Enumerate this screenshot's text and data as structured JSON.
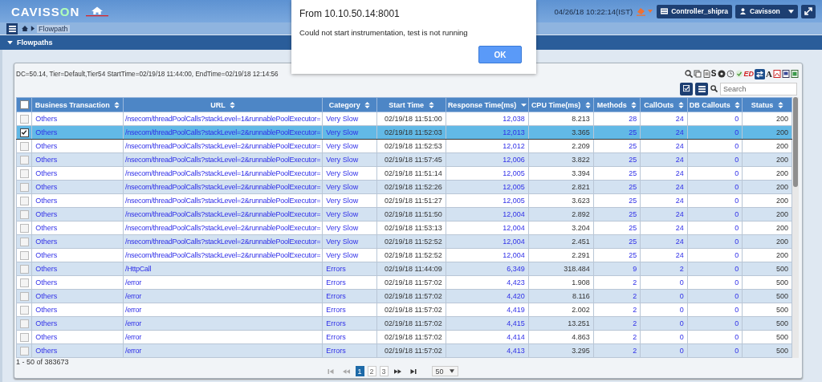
{
  "header": {
    "logo": {
      "before": "CAVISS",
      "accent": "O",
      "after": "N"
    },
    "datetime": "04/26/18 10:22:14(IST)",
    "controller": "Controller_shipra",
    "user": "Cavisson"
  },
  "breadcrumb": {
    "current": "Flowpath"
  },
  "section": {
    "title": "Flowpaths",
    "expanded": true
  },
  "info": "DC=50.14, Tier=Default,Tier54 StartTime=02/19/18 11:44:00, EndTime=02/19/18 12:14:56",
  "toolbar_glyphs": [
    "S",
    "ED",
    "A"
  ],
  "search": {
    "placeholder": "Search"
  },
  "table": {
    "all_checked": false,
    "columns": [
      {
        "label": "Business Transaction",
        "kind": "link",
        "sorted": false
      },
      {
        "label": "URL",
        "kind": "link",
        "sorted": false
      },
      {
        "label": "Category",
        "kind": "link",
        "sorted": false
      },
      {
        "label": "Start Time",
        "kind": "value",
        "sorted": false
      },
      {
        "label": "Response Time(ms)",
        "kind": "count",
        "sorted": true
      },
      {
        "label": "CPU Time(ms)",
        "kind": "value",
        "sorted": false
      },
      {
        "label": "Methods",
        "kind": "count",
        "sorted": false
      },
      {
        "label": "CallOuts",
        "kind": "count",
        "sorted": false
      },
      {
        "label": "DB Callouts",
        "kind": "count",
        "sorted": false
      },
      {
        "label": "Status",
        "kind": "value",
        "sorted": false
      }
    ],
    "rows": [
      {
        "selected": false,
        "checked": false,
        "cells": [
          "Others",
          "/nsecom/threadPoolCalls?stackLevel=1&runnablePoolExecutor=",
          "Very Slow",
          "02/19/18 11:51:00",
          "12,038",
          "8.213",
          "28",
          "24",
          "0",
          "200"
        ]
      },
      {
        "selected": true,
        "checked": true,
        "cells": [
          "Others",
          "/nsecom/threadPoolCalls?stackLevel=2&runnablePoolExecutor=",
          "Very Slow",
          "02/19/18 11:52:03",
          "12,013",
          "3.365",
          "25",
          "24",
          "0",
          "200"
        ]
      },
      {
        "selected": false,
        "checked": false,
        "cells": [
          "Others",
          "/nsecom/threadPoolCalls?stackLevel=2&runnablePoolExecutor=",
          "Very Slow",
          "02/19/18 11:52:53",
          "12,012",
          "2.209",
          "25",
          "24",
          "0",
          "200"
        ]
      },
      {
        "selected": false,
        "checked": false,
        "cells": [
          "Others",
          "/nsecom/threadPoolCalls?stackLevel=2&runnablePoolExecutor=",
          "Very Slow",
          "02/19/18 11:57:45",
          "12,006",
          "3.822",
          "25",
          "24",
          "0",
          "200"
        ]
      },
      {
        "selected": false,
        "checked": false,
        "cells": [
          "Others",
          "/nsecom/threadPoolCalls?stackLevel=1&runnablePoolExecutor=",
          "Very Slow",
          "02/19/18 11:51:14",
          "12,005",
          "3.394",
          "25",
          "24",
          "0",
          "200"
        ]
      },
      {
        "selected": false,
        "checked": false,
        "cells": [
          "Others",
          "/nsecom/threadPoolCalls?stackLevel=2&runnablePoolExecutor=",
          "Very Slow",
          "02/19/18 11:52:26",
          "12,005",
          "2.821",
          "25",
          "24",
          "0",
          "200"
        ]
      },
      {
        "selected": false,
        "checked": false,
        "cells": [
          "Others",
          "/nsecom/threadPoolCalls?stackLevel=2&runnablePoolExecutor=",
          "Very Slow",
          "02/19/18 11:51:27",
          "12,005",
          "3.623",
          "25",
          "24",
          "0",
          "200"
        ]
      },
      {
        "selected": false,
        "checked": false,
        "cells": [
          "Others",
          "/nsecom/threadPoolCalls?stackLevel=2&runnablePoolExecutor=",
          "Very Slow",
          "02/19/18 11:51:50",
          "12,004",
          "2.892",
          "25",
          "24",
          "0",
          "200"
        ]
      },
      {
        "selected": false,
        "checked": false,
        "cells": [
          "Others",
          "/nsecom/threadPoolCalls?stackLevel=2&runnablePoolExecutor=",
          "Very Slow",
          "02/19/18 11:53:13",
          "12,004",
          "3.204",
          "25",
          "24",
          "0",
          "200"
        ]
      },
      {
        "selected": false,
        "checked": false,
        "cells": [
          "Others",
          "/nsecom/threadPoolCalls?stackLevel=2&runnablePoolExecutor=",
          "Very Slow",
          "02/19/18 11:52:52",
          "12,004",
          "2.451",
          "25",
          "24",
          "0",
          "200"
        ]
      },
      {
        "selected": false,
        "checked": false,
        "cells": [
          "Others",
          "/nsecom/threadPoolCalls?stackLevel=2&runnablePoolExecutor=",
          "Very Slow",
          "02/19/18 11:52:52",
          "12,004",
          "2.291",
          "25",
          "24",
          "0",
          "200"
        ]
      },
      {
        "selected": false,
        "checked": false,
        "cells": [
          "Others",
          "/HttpCall",
          "Errors",
          "02/19/18 11:44:09",
          "6,349",
          "318.484",
          "9",
          "2",
          "0",
          "500"
        ]
      },
      {
        "selected": false,
        "checked": false,
        "cells": [
          "Others",
          "/error",
          "Errors",
          "02/19/18 11:57:02",
          "4,423",
          "1.908",
          "2",
          "0",
          "0",
          "500"
        ]
      },
      {
        "selected": false,
        "checked": false,
        "cells": [
          "Others",
          "/error",
          "Errors",
          "02/19/18 11:57:02",
          "4,420",
          "8.116",
          "2",
          "0",
          "0",
          "500"
        ]
      },
      {
        "selected": false,
        "checked": false,
        "cells": [
          "Others",
          "/error",
          "Errors",
          "02/19/18 11:57:02",
          "4,419",
          "2.002",
          "2",
          "0",
          "0",
          "500"
        ]
      },
      {
        "selected": false,
        "checked": false,
        "cells": [
          "Others",
          "/error",
          "Errors",
          "02/19/18 11:57:02",
          "4,415",
          "13.251",
          "2",
          "0",
          "0",
          "500"
        ]
      },
      {
        "selected": false,
        "checked": false,
        "cells": [
          "Others",
          "/error",
          "Errors",
          "02/19/18 11:57:02",
          "4,414",
          "4.863",
          "2",
          "0",
          "0",
          "500"
        ]
      },
      {
        "selected": false,
        "checked": false,
        "cells": [
          "Others",
          "/error",
          "Errors",
          "02/19/18 11:57:02",
          "4,413",
          "3.295",
          "2",
          "0",
          "0",
          "500"
        ]
      }
    ]
  },
  "footer": {
    "count": "1 - 50 of 383673",
    "pages": [
      {
        "label": "1",
        "selected": true
      },
      {
        "label": "2",
        "selected": false
      },
      {
        "label": "3",
        "selected": false
      }
    ],
    "page_size": "50"
  },
  "dialog": {
    "title": "From 10.10.50.14:8001",
    "message": "Could not start instrumentation, test is not running",
    "button": "OK"
  }
}
